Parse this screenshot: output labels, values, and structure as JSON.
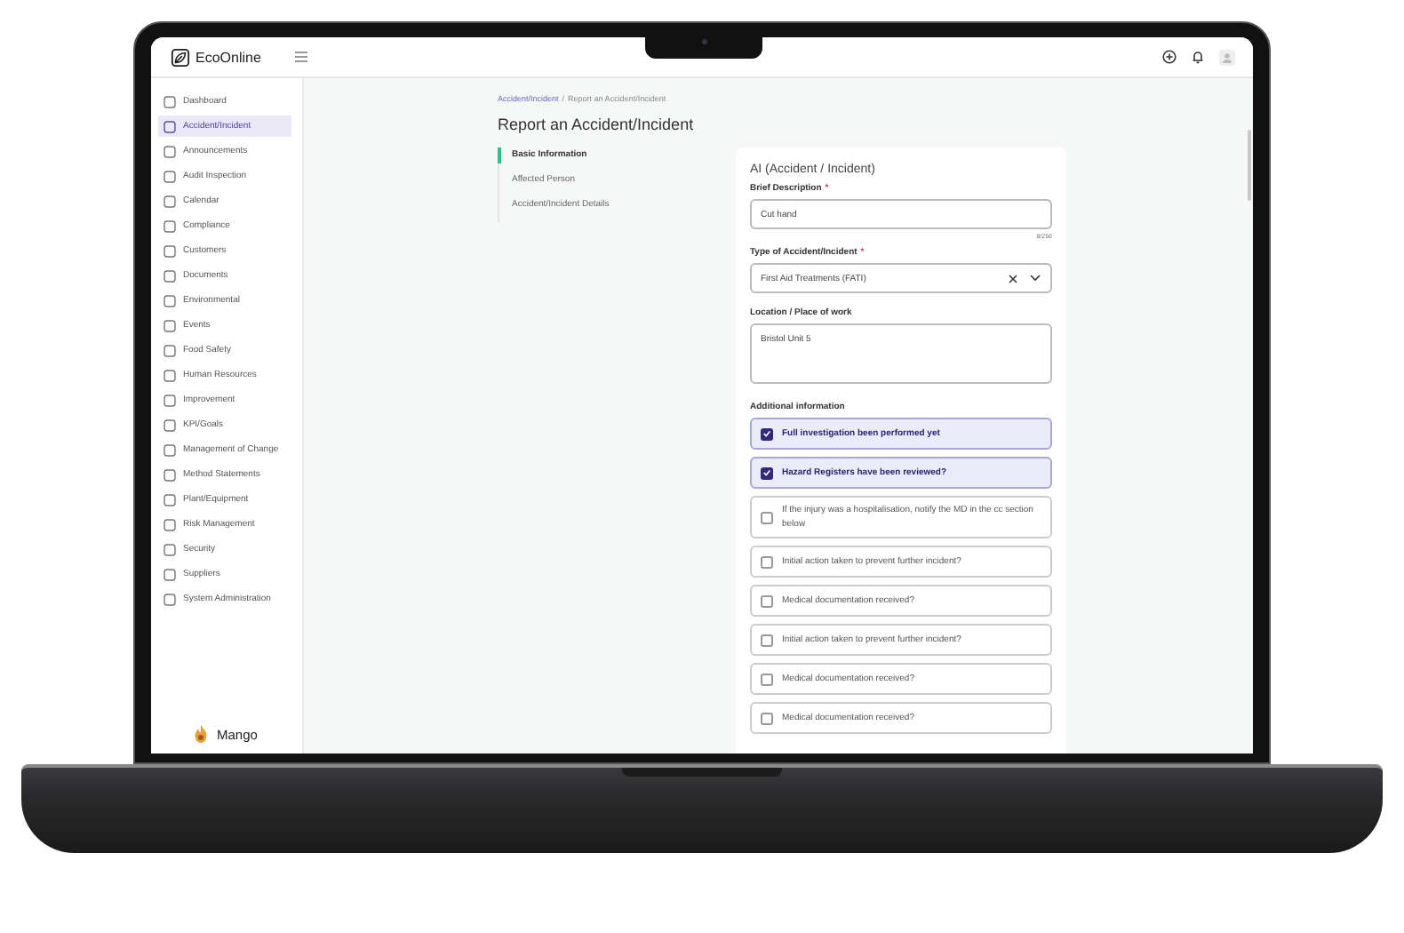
{
  "app": {
    "brand": "EcoOnline",
    "user_name": "Mango"
  },
  "sidebar": {
    "items": [
      {
        "label": "Dashboard",
        "selected": false
      },
      {
        "label": "Accident/Incident",
        "selected": true
      },
      {
        "label": "Announcements",
        "selected": false
      },
      {
        "label": "Audit Inspection",
        "selected": false
      },
      {
        "label": "Calendar",
        "selected": false
      },
      {
        "label": "Compliance",
        "selected": false
      },
      {
        "label": "Customers",
        "selected": false
      },
      {
        "label": "Documents",
        "selected": false
      },
      {
        "label": "Environmental",
        "selected": false
      },
      {
        "label": "Events",
        "selected": false
      },
      {
        "label": "Food Safety",
        "selected": false
      },
      {
        "label": "Human Resources",
        "selected": false
      },
      {
        "label": "Improvement",
        "selected": false
      },
      {
        "label": "KPI/Goals",
        "selected": false
      },
      {
        "label": "Management of Change",
        "selected": false
      },
      {
        "label": "Method Statements",
        "selected": false
      },
      {
        "label": "Plant/Equipment",
        "selected": false
      },
      {
        "label": "Risk Management",
        "selected": false
      },
      {
        "label": "Security",
        "selected": false
      },
      {
        "label": "Suppliers",
        "selected": false
      },
      {
        "label": "System Administration",
        "selected": false
      }
    ]
  },
  "breadcrumb": {
    "items": [
      "Accident/Incident",
      "Report an Accident/Incident"
    ],
    "separator": "/"
  },
  "page_title": "Report an Accident/Incident",
  "steps": [
    {
      "label": "Basic Information",
      "selected": true
    },
    {
      "label": "Affected Person",
      "selected": false
    },
    {
      "label": "Accident/Incident Details",
      "selected": false
    }
  ],
  "form": {
    "title": "AI (Accident / Incident)",
    "fields": [
      {
        "kind": "text",
        "label": "Brief Description",
        "required_mark": "*",
        "value": "Cut hand",
        "counter": "8/256"
      },
      {
        "kind": "select",
        "label": "Type of Accident/Incident",
        "required_mark": "*",
        "value": "First Aid Treatments (FATI)"
      },
      {
        "kind": "textarea",
        "label": "Location / Place of work",
        "value": "Bristol Unit 5"
      }
    ],
    "checklist": {
      "title": "Additional information",
      "items": [
        {
          "label": "Full investigation been performed yet",
          "checked": true
        },
        {
          "label": "Hazard Registers have been reviewed?",
          "checked": true
        },
        {
          "label": "If the injury was a hospitalisation, notify the MD in the cc section below",
          "checked": false
        },
        {
          "label": "Initial action taken to prevent further incident?",
          "checked": false
        },
        {
          "label": "Medical documentation received?",
          "checked": false
        },
        {
          "label": "Initial action taken to prevent further incident?",
          "checked": false
        },
        {
          "label": "Medical documentation received?",
          "checked": false
        },
        {
          "label": "Medical documentation received?",
          "checked": false
        }
      ]
    }
  }
}
